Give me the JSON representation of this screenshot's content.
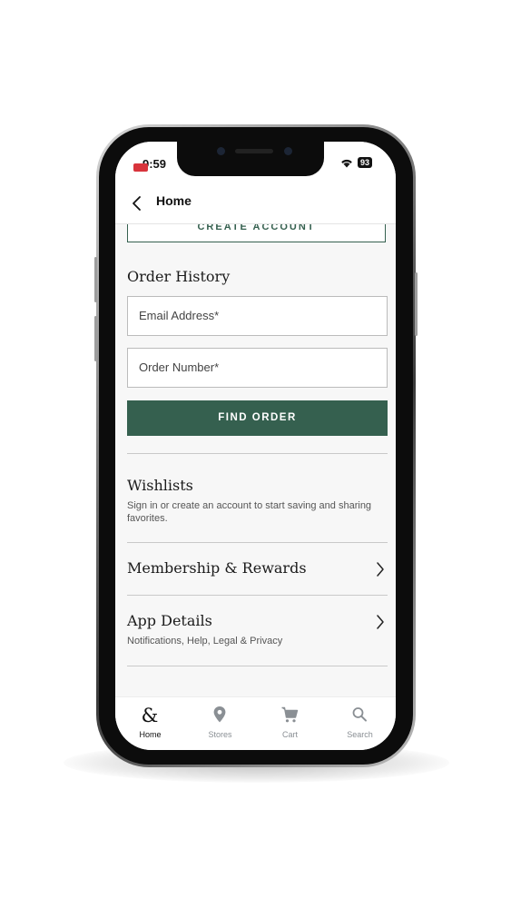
{
  "status": {
    "time": "9:59",
    "battery": "93"
  },
  "nav": {
    "title": "Home"
  },
  "account": {
    "create_label": "CREATE ACCOUNT"
  },
  "order_history": {
    "title": "Order History",
    "email_placeholder": "Email Address*",
    "order_placeholder": "Order Number*",
    "find_label": "FIND ORDER"
  },
  "wishlists": {
    "title": "Wishlists",
    "description": "Sign in or create an account to start saving and sharing favorites."
  },
  "membership": {
    "title": "Membership & Rewards"
  },
  "app_details": {
    "title": "App Details",
    "subtitle": "Notifications, Help, Legal & Privacy"
  },
  "tabbar": {
    "items": [
      {
        "label": "Home",
        "icon": "ampersand-icon"
      },
      {
        "label": "Stores",
        "icon": "location-pin-icon"
      },
      {
        "label": "Cart",
        "icon": "cart-icon"
      },
      {
        "label": "Search",
        "icon": "search-icon"
      }
    ]
  },
  "colors": {
    "brand_green": "#35604f",
    "screen_bg": "#f7f7f7",
    "tab_inactive": "#8a8f94"
  }
}
